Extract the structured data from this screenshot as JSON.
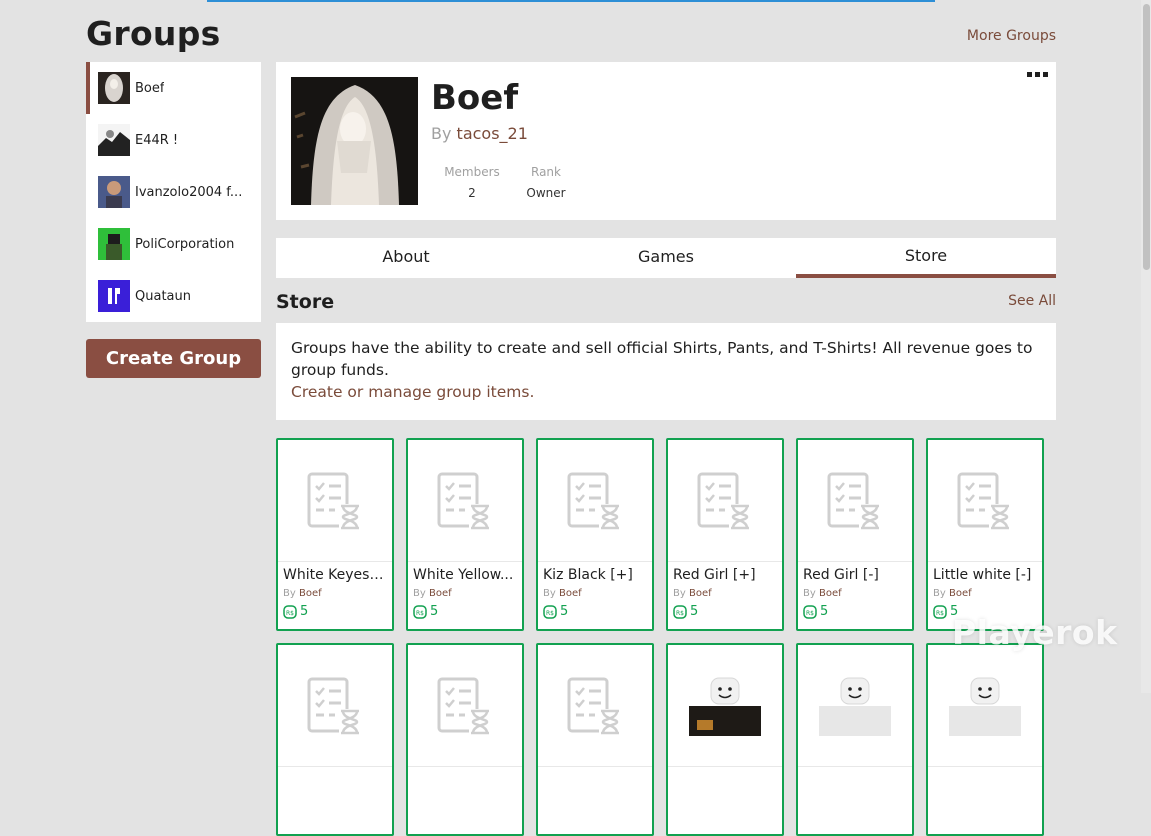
{
  "page": {
    "title": "Groups",
    "more_groups": "More Groups"
  },
  "sidebar": {
    "groups": [
      {
        "name": "Boef",
        "active": true
      },
      {
        "name": "E44R !",
        "active": false
      },
      {
        "name": "Ivanzolo2004 f...",
        "active": false
      },
      {
        "name": "PoliCorporation",
        "active": false
      },
      {
        "name": "Quataun",
        "active": false
      }
    ],
    "create_group": "Create Group"
  },
  "group": {
    "name": "Boef",
    "by_prefix": "By",
    "owner": "tacos_21",
    "stats": [
      {
        "label": "Members",
        "value": "2"
      },
      {
        "label": "Rank",
        "value": "Owner"
      }
    ]
  },
  "tabs": [
    {
      "label": "About",
      "active": false
    },
    {
      "label": "Games",
      "active": false
    },
    {
      "label": "Store",
      "active": true
    }
  ],
  "store": {
    "title": "Store",
    "see_all": "See All",
    "info_text": "Groups have the ability to create and sell official Shirts, Pants, and T-Shirts! All revenue goes to group funds.",
    "manage_link": "Create or manage group items.",
    "items": [
      {
        "name": "White Keyes ...",
        "by_prefix": "By",
        "creator": "Boef",
        "price": "5",
        "thumb": "pending-icon"
      },
      {
        "name": "White Yellow...",
        "by_prefix": "By",
        "creator": "Boef",
        "price": "5",
        "thumb": "pending-icon"
      },
      {
        "name": "Kiz Black [+]",
        "by_prefix": "By",
        "creator": "Boef",
        "price": "5",
        "thumb": "pending-icon"
      },
      {
        "name": "Red Girl [+]",
        "by_prefix": "By",
        "creator": "Boef",
        "price": "5",
        "thumb": "pending-icon"
      },
      {
        "name": "Red Girl [-]",
        "by_prefix": "By",
        "creator": "Boef",
        "price": "5",
        "thumb": "pending-icon"
      },
      {
        "name": "Little white [-]",
        "by_prefix": "By",
        "creator": "Boef",
        "price": "5",
        "thumb": "pending-icon"
      },
      {
        "name": "",
        "by_prefix": "",
        "creator": "",
        "price": "",
        "thumb": "pending-icon"
      },
      {
        "name": "",
        "by_prefix": "",
        "creator": "",
        "price": "",
        "thumb": "pending-icon"
      },
      {
        "name": "",
        "by_prefix": "",
        "creator": "",
        "price": "",
        "thumb": "pending-icon"
      },
      {
        "name": "",
        "by_prefix": "",
        "creator": "",
        "price": "",
        "thumb": "avatar-black-outfit"
      },
      {
        "name": "",
        "by_prefix": "",
        "creator": "",
        "price": "",
        "thumb": "avatar-white-outfit"
      },
      {
        "name": "",
        "by_prefix": "",
        "creator": "",
        "price": "",
        "thumb": "avatar-white-outfit"
      }
    ]
  },
  "watermark": "Playerok",
  "colors": {
    "accent": "#8a4e42",
    "link": "#7a4b3a",
    "price_green": "#12a150",
    "background": "#e3e3e3"
  }
}
